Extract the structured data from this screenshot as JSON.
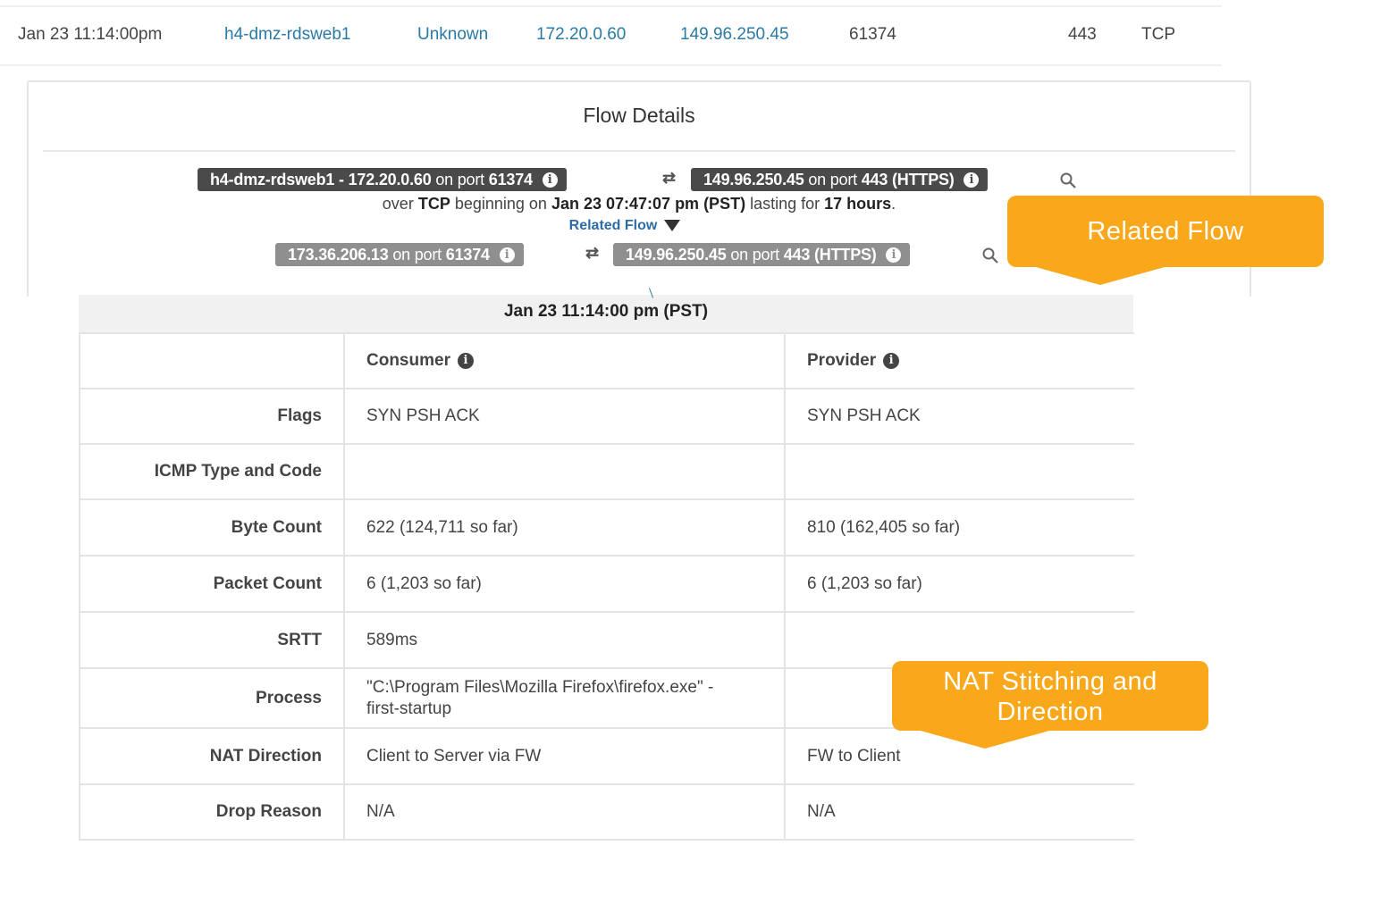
{
  "flow_row": {
    "time": "Jan 23 11:14:00pm",
    "hostname": "h4-dmz-rdsweb1",
    "scope": "Unknown",
    "src_ip": "172.20.0.60",
    "dst_ip": "149.96.250.45",
    "src_port": "61374",
    "dst_port": "443",
    "protocol": "TCP"
  },
  "panel": {
    "title": "Flow Details",
    "main_flow": {
      "src_host_ip": "h4-dmz-rdsweb1 - 172.20.0.60",
      "src_on_port": "on port",
      "src_port": "61374",
      "dst_ip": "149.96.250.45",
      "dst_on_port": "on port",
      "dst_port": "443 (HTTPS)"
    },
    "summary": {
      "over": "over",
      "protocol": "TCP",
      "beginning_on": "beginning on",
      "start": "Jan 23 07:47:07 pm (PST)",
      "lasting_for": "lasting for",
      "duration": "17 hours",
      "period": "."
    },
    "related_flow_label": "Related Flow",
    "related_flow": {
      "src_ip": "173.36.206.13",
      "src_on_port": "on port",
      "src_port": "61374",
      "dst_ip": "149.96.250.45",
      "dst_on_port": "on port",
      "dst_port": "443 (HTTPS)"
    }
  },
  "callouts": {
    "related_flow": "Related Flow",
    "nat_line1": "NAT Stitching and",
    "nat_line2": "Direction"
  },
  "details_table": {
    "timestamp": "Jan 23 11:14:00 pm (PST)",
    "columns": [
      "",
      "Consumer",
      "Provider"
    ],
    "rows": [
      {
        "label": "Flags",
        "consumer": "SYN PSH ACK",
        "provider": "SYN PSH ACK"
      },
      {
        "label": "ICMP Type and Code",
        "consumer": "",
        "provider": ""
      },
      {
        "label": "Byte Count",
        "consumer": "622 (124,711 so far)",
        "provider": "810 (162,405 so far)"
      },
      {
        "label": "Packet Count",
        "consumer": "6 (1,203 so far)",
        "provider": "6 (1,203 so far)"
      },
      {
        "label": "SRTT",
        "consumer": "589ms",
        "provider": ""
      },
      {
        "label": "Process",
        "consumer": "\"C:\\Program Files\\Mozilla Firefox\\firefox.exe\" -",
        "consumer_line2": "first-startup",
        "provider": ""
      },
      {
        "label": "NAT Direction",
        "consumer": "Client to Server via FW",
        "provider": "FW to Client"
      },
      {
        "label": "Drop Reason",
        "consumer": "N/A",
        "provider": "N/A"
      }
    ]
  },
  "colors": {
    "accent_callout": "#f9a81b",
    "link": "#2a7aa5",
    "pill_dark": "#4a4a4a",
    "pill_light": "#8f8f8f"
  }
}
